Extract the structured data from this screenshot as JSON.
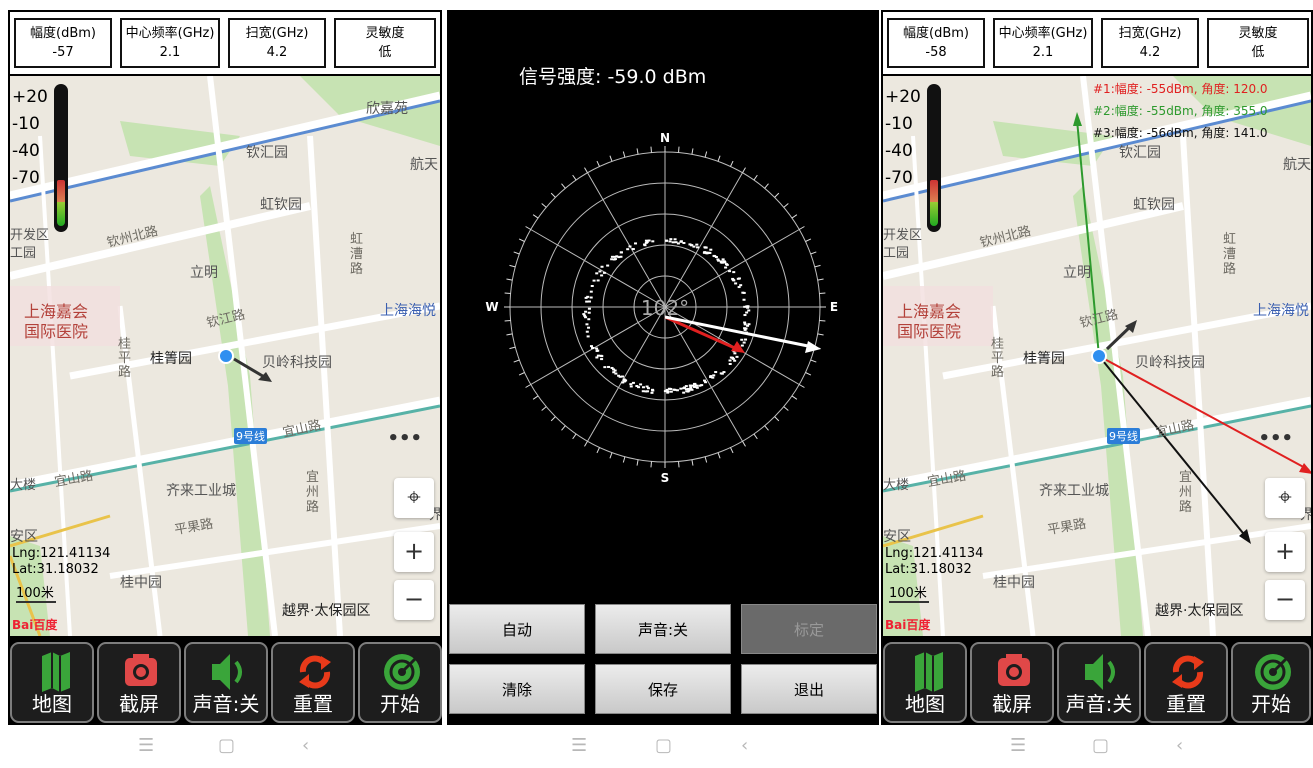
{
  "left": {
    "amplitude_label": "幅度(dBm)",
    "amplitude_value": "-57",
    "freq_label": "中心频率(GHz)",
    "freq_value": "2.1",
    "span_label": "扫宽(GHz)",
    "span_value": "4.2",
    "sens_label": "灵敏度",
    "sens_value": "低",
    "meter_ticks": [
      "+20",
      "-10",
      "-40",
      "-70"
    ],
    "lng": "Lng:121.41134",
    "lat": "Lat:31.18032",
    "scale": "100米",
    "baidu": "Bai百度"
  },
  "right": {
    "amplitude_label": "幅度(dBm)",
    "amplitude_value": "-58",
    "freq_label": "中心频率(GHz)",
    "freq_value": "2.1",
    "span_label": "扫宽(GHz)",
    "span_value": "4.2",
    "sens_label": "灵敏度",
    "sens_value": "低",
    "meter_ticks": [
      "+20",
      "-10",
      "-40",
      "-70"
    ],
    "lng": "Lng:121.41134",
    "lat": "Lat:31.18032",
    "scale": "100米",
    "baidu": "Bai百度",
    "annotations": [
      {
        "text": "#1:幅度: -55dBm, 角度: 120.0",
        "color": "#e02020"
      },
      {
        "text": "#2:幅度: -55dBm, 角度: 355.0",
        "color": "#2e9a2e"
      },
      {
        "text": "#3:幅度: -56dBm, 角度: 141.0",
        "color": "#111111"
      }
    ]
  },
  "map_labels": {
    "xinjiayuan": "欣嘉苑",
    "qinhuiyuan": "钦汇园",
    "hangtian": "航天",
    "hongqinyuan": "虹钦园",
    "qinzhoubeilu": "钦州北路",
    "kaifaqu": "开发区",
    "gongyuan": "工园",
    "liming": "立明",
    "hongcaolu": "虹漕路",
    "shanghaihaiyue": "上海海悦",
    "shanghaijiahui": "上海嘉会",
    "guojiyiyuan": "国际医院",
    "qinjianglu": "钦江路",
    "guipinglu": "桂平路",
    "guijingyuan": "桂箐园",
    "beilingkejiyuan": "贝岭科技园",
    "yishanlu": "宜山路",
    "line9": "9号线",
    "yishanlu2": "宜山路",
    "dalou": "大楼",
    "qilaigongyecheng": "齐来工业城",
    "yizhoulu": "宜州路",
    "pingguolu": "平果路",
    "jie": "界",
    "anqu": "安区",
    "guizhongyuan": "桂中园",
    "yuejietaibao": "越界·太保园区"
  },
  "bottom_buttons": [
    {
      "label": "地图",
      "icon": "map-icon",
      "color": "#3aa53a"
    },
    {
      "label": "截屏",
      "icon": "camera-icon",
      "color": "#e04848"
    },
    {
      "label": "声音:关",
      "icon": "speaker-icon",
      "color": "#3aa53a"
    },
    {
      "label": "重置",
      "icon": "refresh-icon",
      "color": "#e83a1a"
    },
    {
      "label": "开始",
      "icon": "radar-icon",
      "color": "#3aa53a"
    }
  ],
  "middle": {
    "signal_title": "信号强度: -59.0 dBm",
    "bearing": "102°",
    "compass": {
      "n": "N",
      "s": "S",
      "e": "E",
      "w": "W"
    },
    "buttons": {
      "auto": "自动",
      "sound": "声音:关",
      "calibrate": "标定",
      "clear": "清除",
      "save": "保存",
      "exit": "退出"
    }
  },
  "navbar": {
    "menu": "☰",
    "home": "▢",
    "back": "‹"
  },
  "colors": {
    "panel_bg": "#000000",
    "map_bg": "#ece8df",
    "road": "#ffffff",
    "rail": "#5b8bd1",
    "green": "#c7e3b3",
    "arrow_red": "#e02020",
    "arrow_green": "#2e9a2e"
  }
}
